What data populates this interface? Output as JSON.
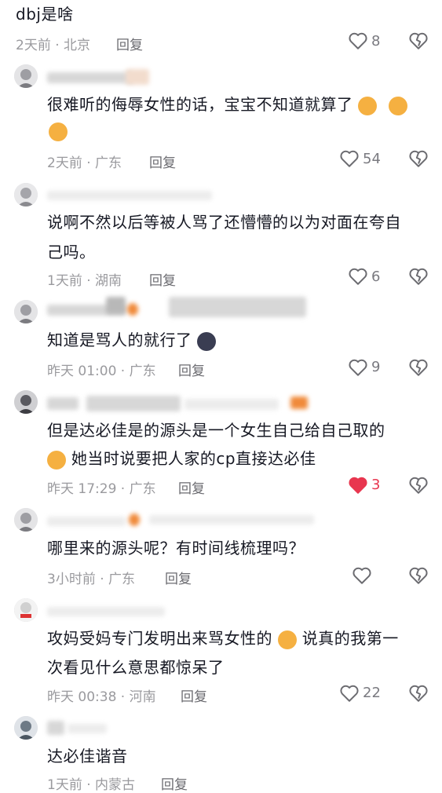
{
  "comments": [
    {
      "text": "dbj是啥",
      "time": "2天前 · 北京",
      "reply": "回复",
      "likes": "8",
      "liked": false
    },
    {
      "text_line1": "很难听的侮辱女性的话，宝宝不知道就算了",
      "time": "2天前 · 广东",
      "reply": "回复",
      "likes": "54",
      "liked": false
    },
    {
      "text_line1": "说啊不然以后等被人骂了还懵懵的以为对面在夸自",
      "text_line2": "己吗。",
      "time": "1天前 · 湖南",
      "reply": "回复",
      "likes": "6",
      "liked": false
    },
    {
      "text_line1": "知道是骂人的就行了",
      "time": "昨天 01:00 · 广东",
      "reply": "回复",
      "likes": "9",
      "liked": false
    },
    {
      "text_line1": "但是达必佳是的源头是一个女生自己给自己取的",
      "text_line2": "她当时说要把人家的cp直接达必佳",
      "time": "昨天 17:29 · 广东",
      "reply": "回复",
      "likes": "3",
      "liked": true
    },
    {
      "text_line1": "哪里来的源头呢？有时间线梳理吗？",
      "time": "3小时前 · 广东",
      "reply": "回复",
      "likes": "",
      "liked": false
    },
    {
      "text_line1": "攻妈受妈专门发明出来骂女性的",
      "text_line1b": "说真的我第一",
      "text_line2": "次看见什么意思都惊呆了",
      "time": "昨天 00:38 · 河南",
      "reply": "回复",
      "likes": "22",
      "liked": false
    },
    {
      "text_line1": "达必佳谐音",
      "time": "1天前 · 内蒙古",
      "reply": "回复"
    }
  ],
  "colors": {
    "liked": "#e8364f",
    "text": "#161823",
    "meta": "#9a9a9e"
  }
}
